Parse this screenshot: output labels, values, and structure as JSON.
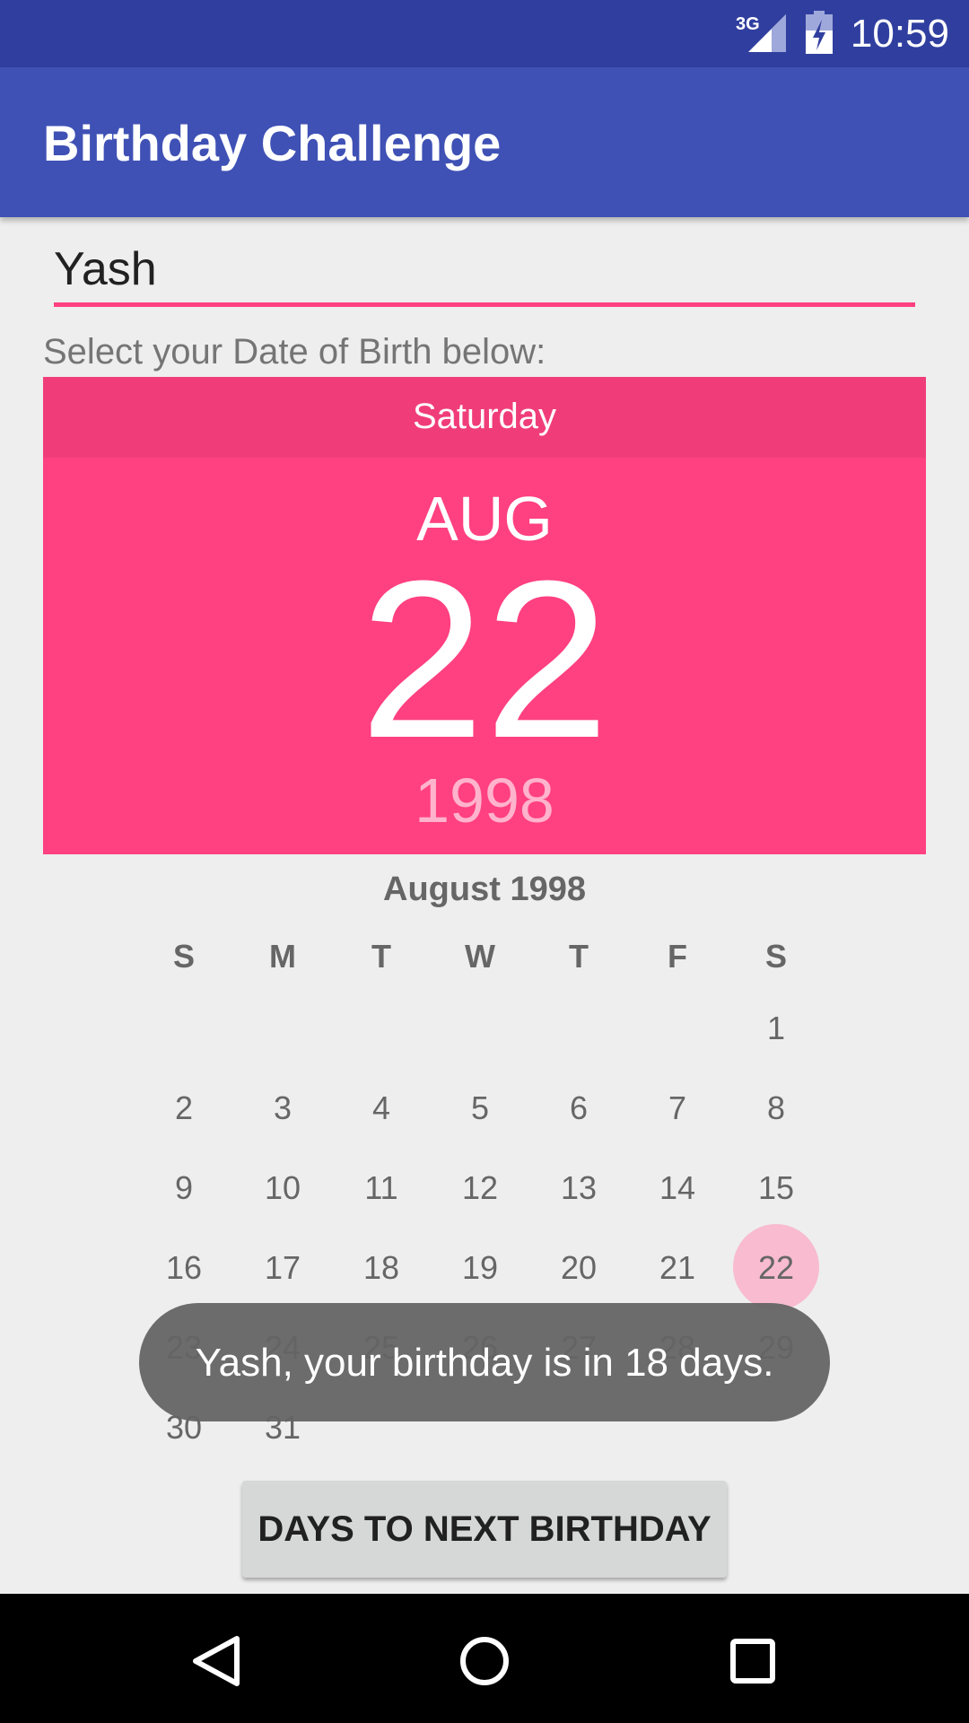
{
  "status_bar": {
    "network": "3G",
    "time": "10:59",
    "signal_icon": "signal-icon",
    "battery_icon": "battery-charging-icon"
  },
  "app_bar": {
    "title": "Birthday Challenge"
  },
  "form": {
    "name_value": "Yash",
    "dob_label": "Select your Date of Birth below:"
  },
  "date_picker": {
    "weekday": "Saturday",
    "month": "AUG",
    "day": "22",
    "year": "1998",
    "month_title": "August 1998",
    "day_headers": [
      "S",
      "M",
      "T",
      "W",
      "T",
      "F",
      "S"
    ],
    "days": [
      "1",
      "2",
      "3",
      "4",
      "5",
      "6",
      "7",
      "8",
      "9",
      "10",
      "11",
      "12",
      "13",
      "14",
      "15",
      "16",
      "17",
      "18",
      "19",
      "20",
      "21",
      "22",
      "23",
      "24",
      "25",
      "26",
      "27",
      "28",
      "29",
      "30",
      "31"
    ],
    "selected_day": "22",
    "accent_color": "#ff4081",
    "selected_circle_color": "#f8bbd0"
  },
  "toast": {
    "message": "Yash, your birthday is in 18 days."
  },
  "action": {
    "button_label": "DAYS TO NEXT BIRTHDAY"
  },
  "nav_bar": {
    "back_icon": "back-icon",
    "home_icon": "home-icon",
    "recents_icon": "recents-icon"
  },
  "colors": {
    "status_bar": "#303f9f",
    "app_bar": "#3f51b5",
    "header": "#ff4081"
  }
}
